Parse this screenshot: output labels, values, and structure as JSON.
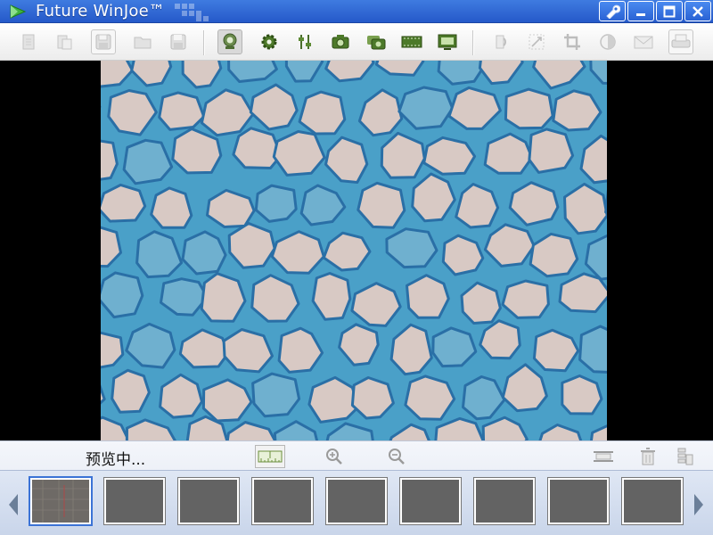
{
  "window": {
    "title": "Future WinJoe™",
    "buttons": [
      "wrench-icon",
      "minimize-icon",
      "maximize-icon",
      "close-icon"
    ]
  },
  "toolbar": {
    "items": [
      {
        "icon": "new-icon",
        "enabled": false
      },
      {
        "icon": "paste-icon",
        "enabled": false
      },
      {
        "icon": "save-as-icon",
        "enabled": false
      },
      {
        "icon": "open-folder-icon",
        "enabled": false
      },
      {
        "icon": "save-icon",
        "enabled": false
      },
      {
        "icon": "webcam-icon",
        "enabled": true,
        "selected": true
      },
      {
        "icon": "settings-gear-icon",
        "enabled": true
      },
      {
        "icon": "adjust-sliders-icon",
        "enabled": true
      },
      {
        "icon": "camera-icon",
        "enabled": true
      },
      {
        "icon": "multi-camera-icon",
        "enabled": true
      },
      {
        "icon": "film-strip-icon",
        "enabled": true
      },
      {
        "icon": "monitor-capture-icon",
        "enabled": true
      },
      {
        "icon": "rotate-icon",
        "enabled": false
      },
      {
        "icon": "resize-icon",
        "enabled": false
      },
      {
        "icon": "crop-icon",
        "enabled": false
      },
      {
        "icon": "contrast-icon",
        "enabled": false
      },
      {
        "icon": "email-icon",
        "enabled": false
      },
      {
        "icon": "print-icon",
        "enabled": false
      }
    ]
  },
  "preview": {
    "image": "microscope-cell-preview"
  },
  "bottom": {
    "status": "预览中...",
    "tools": [
      "ruler-icon",
      "zoom-in-icon",
      "zoom-out-icon",
      "fit-width-icon",
      "delete-icon",
      "delete-all-icon"
    ]
  },
  "thumbnails": {
    "count": 9,
    "selected_index": 0
  },
  "colors": {
    "titlebar": "#2f6ad8",
    "cell_wall": "#2a6fa6",
    "cell_fill": "#d8c9c4",
    "stain": "#4aa0c8"
  }
}
